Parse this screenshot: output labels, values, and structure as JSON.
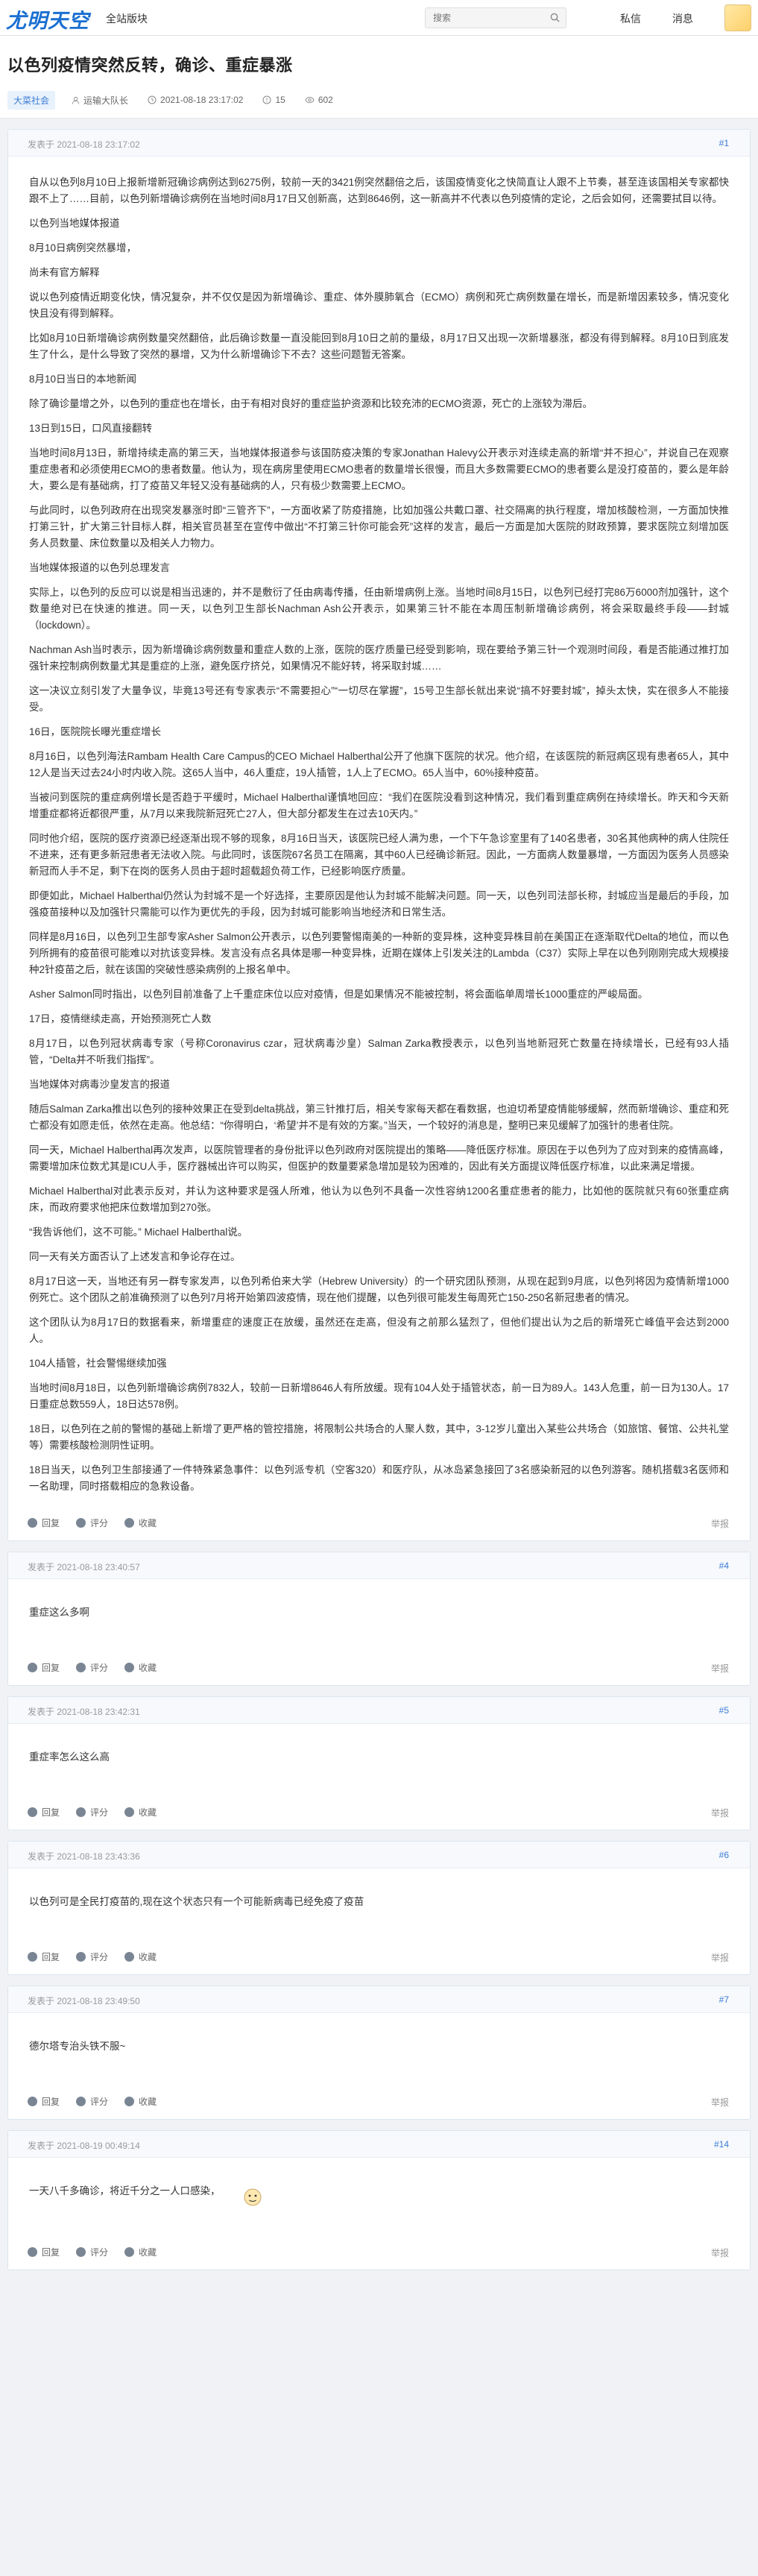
{
  "site": {
    "logo": "尤明天空",
    "nav_all": "全站版块",
    "search_placeholder": "搜索",
    "nav_messages": "私信",
    "nav_notice": "消息"
  },
  "thread": {
    "title": "以色列疫情突然反转，确诊、重症暴涨",
    "tag": "大菜社会",
    "author": "运输大队长",
    "date": "2021-08-18 23:17:02",
    "comments": "15",
    "views": "602"
  },
  "actions": {
    "reply": "回复",
    "rate": "评分",
    "fav": "收藏",
    "report": "举报"
  },
  "posts": [
    {
      "time": "发表于 2021-08-18 23:17:02",
      "floor": "#1",
      "paragraphs": [
        "自从以色列8月10日上报新增新冠确诊病例达到6275例，较前一天的3421例突然翻倍之后，该国疫情变化之快简直让人跟不上节奏，甚至连该国相关专家都快跟不上了……目前，以色列新增确诊病例在当地时间8月17日又创新高，达到8646例，这一新高并不代表以色列疫情的定论，之后会如何，还需要拭目以待。",
        "以色列当地媒体报道",
        "8月10日病例突然暴增，",
        "尚未有官方解释",
        "说以色列疫情近期变化快，情况复杂，并不仅仅是因为新增确诊、重症、体外膜肺氧合（ECMO）病例和死亡病例数量在增长，而是新增因素较多，情况变化快且没有得到解释。",
        "比如8月10日新增确诊病例数量突然翻倍，此后确诊数量一直没能回到8月10日之前的量级，8月17日又出现一次新增暴涨，都没有得到解释。8月10日到底发生了什么，是什么导致了突然的暴增，又为什么新增确诊下不去？这些问题暂无答案。",
        "8月10日当日的本地新闻",
        "除了确诊量增之外，以色列的重症也在增长，由于有相对良好的重症监护资源和比较充沛的ECMO资源，死亡的上涨较为滞后。",
        "13日到15日，口风直接翻转",
        "当地时间8月13日，新增持续走高的第三天，当地媒体报道参与该国防疫决策的专家Jonathan Halevy公开表示对连续走高的新增“并不担心”，并说自己在观察重症患者和必须使用ECMO的患者数量。他认为，现在病房里使用ECMO患者的数量增长很慢，而且大多数需要ECMO的患者要么是没打疫苗的，要么是年龄大，要么是有基础病，打了疫苗又年轻又没有基础病的人，只有极少数需要上ECMO。",
        "与此同时，以色列政府在出现突发暴涨时即“三管齐下”，一方面收紧了防疫措施，比如加强公共戴口罩、社交隔离的执行程度，增加核酸检测，一方面加快推打第三针，扩大第三针目标人群，相关官员甚至在宣传中做出“不打第三针你可能会死”这样的发言，最后一方面是加大医院的财政预算，要求医院立刻增加医务人员数量、床位数量以及相关人力物力。",
        "当地媒体报道的以色列总理发言",
        "实际上，以色列的反应可以说是相当迅速的，并不是敷衍了任由病毒传播，任由新增病例上涨。当地时间8月15日，以色列已经打完86万6000剂加强针，这个数量绝对已在快速的推进。同一天，以色列卫生部长Nachman Ash公开表示，如果第三针不能在本周压制新增确诊病例，将会采取最终手段——封城（lockdown）。",
        "Nachman Ash当时表示，因为新增确诊病例数量和重症人数的上涨，医院的医疗质量已经受到影响，现在要给予第三针一个观测时间段，看是否能通过推打加强针来控制病例数量尤其是重症的上涨，避免医疗挤兑，如果情况不能好转，将采取封城……",
        "这一决议立刻引发了大量争议，毕竟13号还有专家表示“不需要担心”“一切尽在掌握”，15号卫生部长就出来说“搞不好要封城”，掉头太快，实在很多人不能接受。",
        "16日，医院院长曝光重症增长",
        "8月16日，以色列海法Rambam Health Care Campus的CEO Michael Halberthal公开了他旗下医院的状况。他介绍，在该医院的新冠病区现有患者65人，其中12人是当天过去24小时内收入院。这65人当中，46人重症，19人插管，1人上了ECMO。65人当中，60%接种疫苗。",
        "当被问到医院的重症病例增长是否趋于平缓时，Michael Halberthal谨慎地回应：“我们在医院没看到这种情况，我们看到重症病例在持续增长。昨天和今天新增重症都将近都很严重，从7月以来我院新冠死亡27人，但大部分都发生在过去10天内。”",
        "同时他介绍，医院的医疗资源已经逐渐出现不够的现象，8月16日当天，该医院已经人满为患，一个下午急诊室里有了140名患者，30名其他病种的病人住院任不进来，还有更多新冠患者无法收入院。与此同时，该医院67名员工在隔离，其中60人已经确诊新冠。因此，一方面病人数量暴增，一方面因为医务人员感染新冠而人手不足，剩下在岗的医务人员由于超时超载超负荷工作，已经影响医疗质量。",
        "即便如此，Michael Halberthal仍然认为封城不是一个好选择，主要原因是他认为封城不能解决问题。同一天，以色列司法部长称，封城应当是最后的手段，加强疫苗接种以及加强针只需能可以作为更优先的手段，因为封城可能影响当地经济和日常生活。",
        "同样是8月16日，以色列卫生部专家Asher Salmon公开表示，以色列要警惕南美的一种新的变异株，这种变异株目前在美国正在逐渐取代Delta的地位，而以色列所拥有的疫苗很可能难以对抗该变异株。发言没有点名具体是哪一种变异株，近期在媒体上引发关注的Lambda（C37）实际上早在以色列刚刚完成大规模接种2针疫苗之后，就在该国的突破性感染病例的上报名单中。",
        "Asher Salmon同时指出，以色列目前准备了上千重症床位以应对疫情，但是如果情况不能被控制，将会面临单周增长1000重症的严峻局面。",
        "17日，疫情继续走高，开始预测死亡人数",
        "8月17日，以色列冠状病毒专家（号称Coronavirus czar，冠状病毒沙皇）Salman Zarka教授表示，以色列当地新冠死亡数量在持续增长，已经有93人插管，“Delta并不听我们指挥”。",
        "当地媒体对病毒沙皇发言的报道",
        "随后Salman Zarka推出以色列的接种效果正在受到delta挑战，第三针推打后，相关专家每天都在看数据，也迫切希望疫情能够缓解，然而新增确诊、重症和死亡都没有如愿走低，依然在走高。他总结：“你得明白，‘希望’并不是有效的方案。”当天，一个较好的消息是，整明已来见缓解了加强针的患者住院。",
        "同一天，Michael Halberthal再次发声，以医院管理者的身份批评以色列政府对医院提出的策略——降低医疗标准。原因在于以色列为了应对到来的疫情高峰，需要增加床位数尤其是ICU人手，医疗器械出许可以购买，但医护的数量要紧急增加是较为困难的，因此有关方面提议降低医疗标准，以此来满足增援。",
        "Michael Halberthal对此表示反对，并认为这种要求是强人所难，他认为以色列不具备一次性容纳1200名重症患者的能力，比如他的医院就只有60张重症病床，而政府要求他把床位数增加到270张。",
        "“我告诉他们，这不可能。” Michael Halberthal说。",
        "同一天有关方面否认了上述发言和争论存在过。",
        "8月17日这一天，当地还有另一群专家发声，以色列希伯来大学（Hebrew University）的一个研究团队预测，从现在起到9月底，以色列将因为疫情新增1000例死亡。这个团队之前准确预测了以色列7月将开始第四波疫情，现在他们提醒，以色列很可能发生每周死亡150-250名新冠患者的情况。",
        "这个团队认为8月17日的数据看来，新增重症的速度正在放缓，虽然还在走高，但没有之前那么猛烈了，但他们提出认为之后的新增死亡峰值平会达到2000人。",
        "104人插管，社会警惕继续加强",
        "当地时间8月18日，以色列新增确诊病例7832人，较前一日新增8646人有所放缓。现有104人处于插管状态，前一日为89人。143人危重，前一日为130人。17日重症总数559人，18日达578例。",
        "18日，以色列在之前的警惕的基础上新增了更严格的管控措施，将限制公共场合的人聚人数，其中，3-12岁儿童出入某些公共场合（如旅馆、餐馆、公共礼堂等）需要核酸检测阴性证明。",
        "18日当天，以色列卫生部接通了一件特殊紧急事件：以色列派专机（空客320）和医疗队，从冰岛紧急接回了3名感染新冠的以色列游客。随机搭载3名医师和一名助理，同时搭载相应的急救设备。"
      ]
    },
    {
      "time": "发表于 2021-08-18 23:40:57",
      "floor": "#4",
      "paragraphs": [
        "重症这么多啊"
      ]
    },
    {
      "time": "发表于 2021-08-18 23:42:31",
      "floor": "#5",
      "paragraphs": [
        "重症率怎么这么高"
      ]
    },
    {
      "time": "发表于 2021-08-18 23:43:36",
      "floor": "#6",
      "paragraphs": [
        "以色列可是全民打疫苗的,现在这个状态只有一个可能新病毒已经免疫了疫苗"
      ]
    },
    {
      "time": "发表于 2021-08-18 23:49:50",
      "floor": "#7",
      "paragraphs": [
        "德尔塔专治头铁不服~"
      ]
    },
    {
      "time": "发表于 2021-08-19 00:49:14",
      "floor": "#14",
      "paragraphs": [
        "一天八千多确诊，将近千分之一人口感染，"
      ]
    }
  ]
}
